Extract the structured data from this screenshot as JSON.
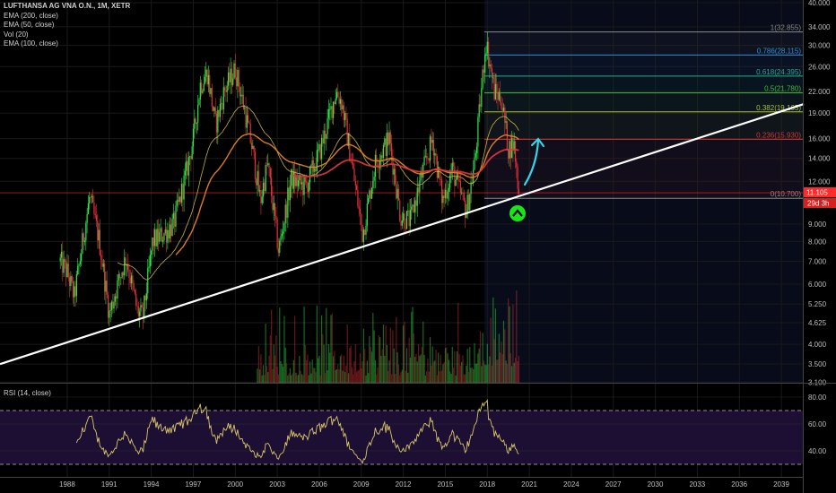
{
  "legend": {
    "title": "LUFTHANSA AG VNA O.N., 1M, XETR",
    "indicators": [
      "EMA (200, close)",
      "EMA (50, close)",
      "Vol (20)",
      "EMA (100, close)"
    ]
  },
  "rsi_legend": "RSI (14, close)",
  "colors": {
    "background": "#000000",
    "up": "#2ee84a",
    "down": "#e2333a",
    "ema50": "#d8c24a",
    "ema100": "#f08a2a",
    "ema200": "#e0393e",
    "trendline": "#ffffff",
    "rsi": "#d8c56a",
    "rsi_band": "#1c0f33",
    "arrow": "#35d6e8",
    "signal": "#19e619",
    "last_price": "#ff2a2a"
  },
  "chart_data": {
    "type": "candlestick",
    "symbol": "LUFTHANSA AG VNA O.N.",
    "interval": "1M",
    "exchange": "XETR",
    "yscale": "log",
    "ylim": [
      3.1,
      40
    ],
    "xlim": [
      1983.2,
      2040.6
    ],
    "price_path": [
      [
        1987.5,
        7.0
      ],
      [
        1988.0,
        6.5
      ],
      [
        1988.5,
        5.5
      ],
      [
        1989.0,
        7.5
      ],
      [
        1989.6,
        10.8
      ],
      [
        1990.3,
        8.0
      ],
      [
        1991.0,
        4.9
      ],
      [
        1991.6,
        6.0
      ],
      [
        1992.2,
        7.2
      ],
      [
        1993.0,
        5.0
      ],
      [
        1993.4,
        4.8
      ],
      [
        1994.1,
        8.0
      ],
      [
        1995.0,
        8.5
      ],
      [
        1995.6,
        9.0
      ],
      [
        1996.4,
        12.2
      ],
      [
        1997.0,
        16.0
      ],
      [
        1997.5,
        23.0
      ],
      [
        1998.0,
        25.0
      ],
      [
        1998.6,
        17.5
      ],
      [
        1999.2,
        22.0
      ],
      [
        2000.0,
        25.6
      ],
      [
        2000.6,
        20.0
      ],
      [
        2001.2,
        15.0
      ],
      [
        2001.8,
        10.5
      ],
      [
        2002.3,
        13.6
      ],
      [
        2003.1,
        7.5
      ],
      [
        2004.0,
        12.2
      ],
      [
        2005.0,
        11.5
      ],
      [
        2006.0,
        14.5
      ],
      [
        2007.2,
        22.0
      ],
      [
        2007.6,
        20.5
      ],
      [
        2008.2,
        14.5
      ],
      [
        2009.1,
        8.4
      ],
      [
        2010.0,
        13.6
      ],
      [
        2011.0,
        16.0
      ],
      [
        2011.8,
        9.5
      ],
      [
        2012.5,
        9.2
      ],
      [
        2013.2,
        12.0
      ],
      [
        2014.1,
        16.0
      ],
      [
        2014.8,
        10.5
      ],
      [
        2015.5,
        13.0
      ],
      [
        2016.5,
        9.8
      ],
      [
        2017.1,
        13.6
      ],
      [
        2017.9,
        31.0
      ],
      [
        2018.5,
        22.0
      ],
      [
        2019.0,
        21.0
      ],
      [
        2019.5,
        15.0
      ],
      [
        2019.9,
        15.5
      ],
      [
        2020.25,
        11.1
      ]
    ],
    "price_ticks": [
      "40.000",
      "34.000",
      "30.000",
      "26.000",
      "22.000",
      "19.000",
      "16.000",
      "14.000",
      "12.000",
      "9.000",
      "8.000",
      "7.000",
      "6.000",
      "5.250",
      "4.625",
      "4.000",
      "3.500",
      "3.100"
    ],
    "price_tick_values": [
      40,
      34,
      30,
      26,
      22,
      19,
      16,
      14,
      12,
      9,
      8,
      7,
      6,
      5.25,
      4.625,
      4,
      3.5,
      3.1
    ],
    "x_ticks": [
      "1988",
      "1991",
      "1994",
      "1997",
      "2000",
      "2003",
      "2006",
      "2009",
      "2012",
      "2015",
      "2018",
      "2021",
      "2024",
      "2027",
      "2030",
      "2033",
      "2036",
      "2039"
    ],
    "last_price": "11.105",
    "countdown": "29d 3h",
    "last_price_value": 11.105,
    "fib_levels": [
      {
        "label": "1(32.855)",
        "value": 32.855,
        "color": "#8a8a8a"
      },
      {
        "label": "0.786(28.115)",
        "value": 28.115,
        "color": "#2f8fd0"
      },
      {
        "label": "0.618(24.395)",
        "value": 24.395,
        "color": "#1fae8a"
      },
      {
        "label": "0.5(21.780)",
        "value": 21.78,
        "color": "#3cbf3c"
      },
      {
        "label": "0.382(19.165)",
        "value": 19.165,
        "color": "#a8c23a"
      },
      {
        "label": "0.236(15.930)",
        "value": 15.93,
        "color": "#d03838"
      },
      {
        "label": "0(10.700)",
        "value": 10.7,
        "color": "#8a8a8a"
      }
    ],
    "trendline": {
      "from": [
        1983.2,
        3.5
      ],
      "to": [
        2040.6,
        20.2
      ]
    },
    "rsi": {
      "period": 14,
      "ticks": [
        "80.00",
        "60.00",
        "40.00"
      ],
      "tick_values": [
        80,
        60,
        40
      ],
      "bands": [
        70,
        30
      ]
    },
    "ema_periods": [
      50,
      100,
      200
    ]
  }
}
